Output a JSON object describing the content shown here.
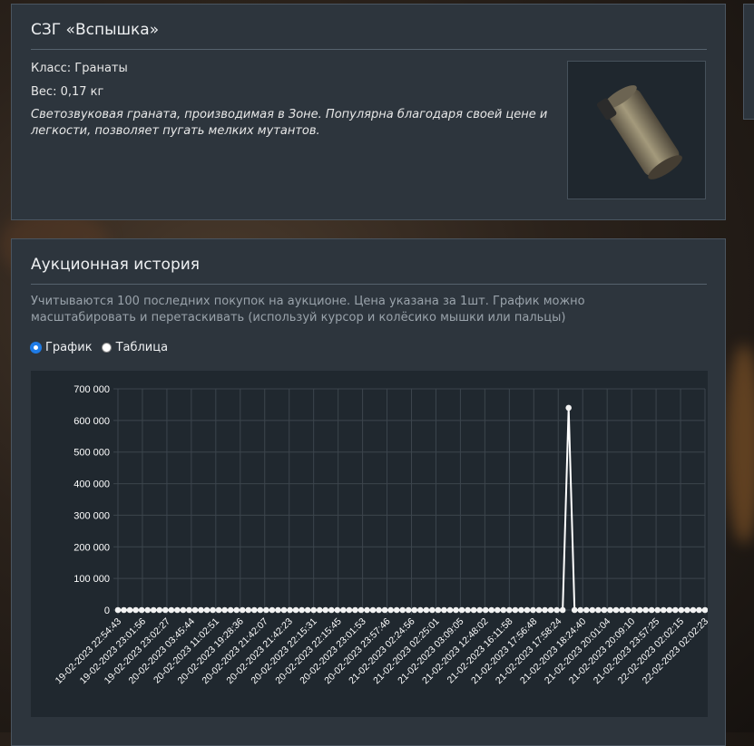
{
  "item": {
    "title": "СЗГ «Вспышка»",
    "class_text": "Класс: Гранаты",
    "weight_text": "Вес: 0,17 кг",
    "description": "Светозвуковая граната, производимая в Зоне. Популярна благодаря своей цене и легкости, позволяет пугать мелких мутантов."
  },
  "history": {
    "title": "Аукционная история",
    "note": "Учитываются 100 последних покупок на аукционе. Цена указана за 1шт. График можно масштабировать и перетаскивать (используй курсор и колёсико мышки или пальцы)",
    "view_options": [
      {
        "label": "График",
        "selected": true
      },
      {
        "label": "Таблица",
        "selected": false
      }
    ]
  },
  "colors": {
    "panel_bg": "#2d353d",
    "chart_bg": "#20282f",
    "line": "#ffffff",
    "radio_accent": "#1e7be6"
  },
  "chart_data": {
    "type": "line",
    "title": "",
    "xlabel": "",
    "ylabel": "",
    "ylim": [
      0,
      700000
    ],
    "y_ticks": [
      "0",
      "100 000",
      "200 000",
      "300 000",
      "400 000",
      "500 000",
      "600 000",
      "700 000"
    ],
    "grid": true,
    "point_count": 100,
    "x_tick_labels": [
      "19-02-2023 22:54:43",
      "19-02-2023 23:01:56",
      "19-02-2023 23:02:27",
      "20-02-2023 03:45:44",
      "20-02-2023 11:02:51",
      "20-02-2023 19:28:36",
      "20-02-2023 21:42:07",
      "20-02-2023 21:42:23",
      "20-02-2023 22:15:31",
      "20-02-2023 22:15:45",
      "20-02-2023 23:01:53",
      "20-02-2023 23:57:46",
      "21-02-2023 02:24:56",
      "21-02-2023 02:25:01",
      "21-02-2023 03:09:05",
      "21-02-2023 12:48:02",
      "21-02-2023 16:11:58",
      "21-02-2023 17:56:48",
      "21-02-2023 17:58:24",
      "21-02-2023 18:24:40",
      "21-02-2023 20:01:04",
      "21-02-2023 20:09:10",
      "21-02-2023 23:57:25",
      "22-02-2023 02:02:15",
      "22-02-2023 02:02:23"
    ],
    "series": [
      {
        "values": [
          0,
          0,
          0,
          0,
          0,
          0,
          0,
          0,
          0,
          0,
          0,
          0,
          0,
          0,
          0,
          0,
          0,
          0,
          0,
          0,
          0,
          0,
          0,
          0,
          0,
          0,
          0,
          0,
          0,
          0,
          0,
          0,
          0,
          0,
          0,
          0,
          0,
          0,
          0,
          0,
          0,
          0,
          0,
          0,
          0,
          0,
          0,
          0,
          0,
          0,
          0,
          0,
          0,
          0,
          0,
          0,
          0,
          0,
          0,
          0,
          0,
          0,
          0,
          0,
          0,
          0,
          0,
          0,
          0,
          0,
          0,
          0,
          0,
          0,
          0,
          0,
          640000,
          0,
          0,
          0,
          0,
          0,
          0,
          0,
          0,
          0,
          0,
          0,
          0,
          0,
          0,
          0,
          0,
          0,
          0,
          0,
          0,
          0,
          0,
          0
        ]
      }
    ]
  }
}
